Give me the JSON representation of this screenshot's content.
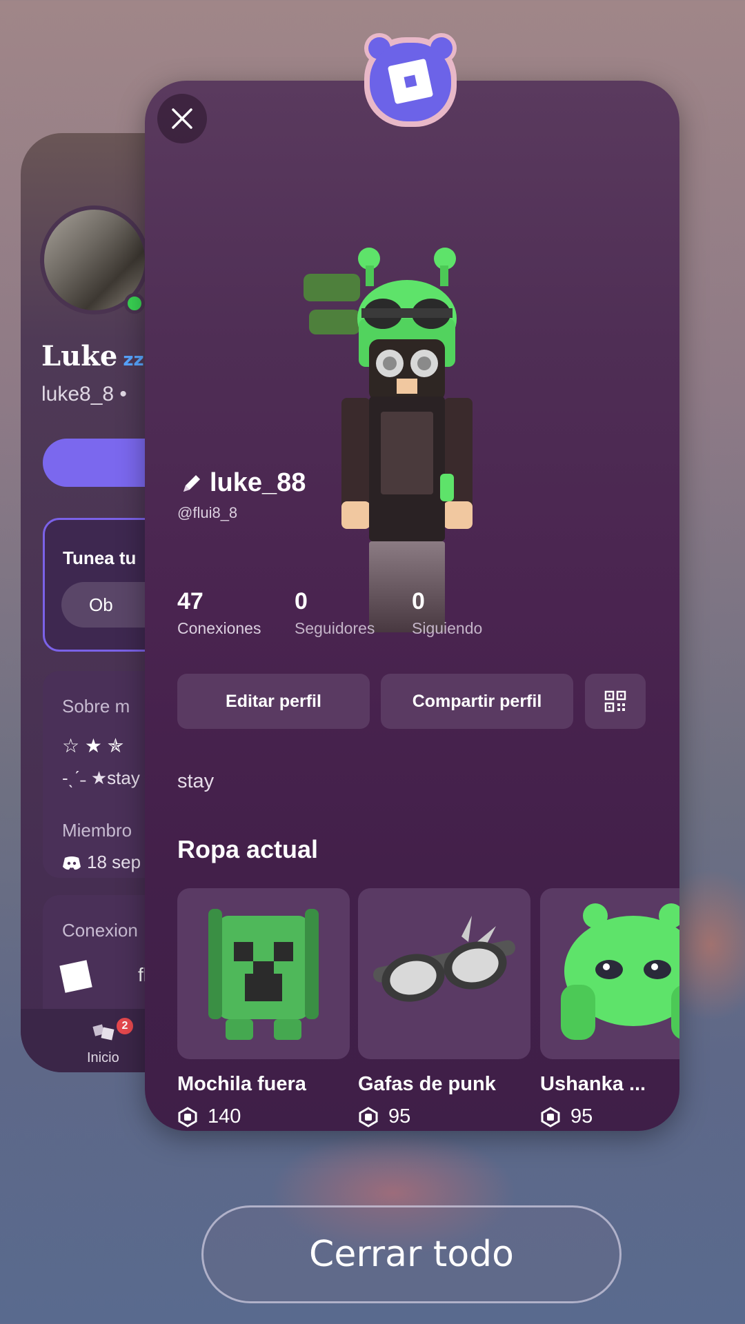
{
  "back_card": {
    "display_name": "Luke",
    "zz": "zz",
    "username": "luke8_8 •",
    "tunea_title": "Tunea tu",
    "tunea_button": "Ob",
    "about_title": "Sobre m",
    "about_stars": "☆ ★ ✯",
    "about_status": "-ˎˊ˗ ★stay",
    "member_label": "Miembro",
    "member_date": "18 sep",
    "connections_title": "Conexion",
    "connection_name": "flu",
    "nav_home_label": "Inicio",
    "nav_badge": "2"
  },
  "profile": {
    "display_name": "luke_88",
    "handle": "@flui8_8",
    "bio": "stay",
    "stats": [
      {
        "value": "47",
        "label": "Conexiones"
      },
      {
        "value": "0",
        "label": "Seguidores"
      },
      {
        "value": "0",
        "label": "Siguiendo"
      }
    ],
    "edit_button": "Editar perfil",
    "share_button": "Compartir perfil",
    "qr_icon": "qr-code-icon"
  },
  "outfit": {
    "title": "Ropa actual",
    "items": [
      {
        "name": "Mochila fuera",
        "price": "140",
        "icon": "creeper-backpack"
      },
      {
        "name": "Gafas de punk",
        "price": "95",
        "icon": "punk-goggles"
      },
      {
        "name": "Ushanka ...",
        "price": "95",
        "icon": "alien-ushanka"
      }
    ]
  },
  "close_all_label": "Cerrar todo",
  "colors": {
    "accent": "#7b68ee",
    "card_bg": "#4a2450",
    "online": "#39d353",
    "badge": "#e5484d",
    "item_green": "#5ee36a"
  }
}
